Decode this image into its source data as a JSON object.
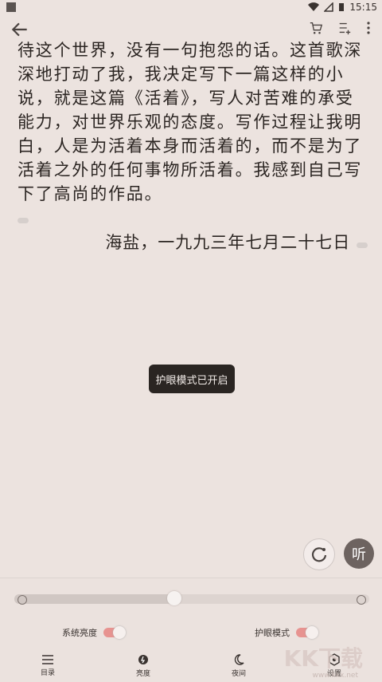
{
  "status": {
    "time": "15:15"
  },
  "reader": {
    "text": "待这个世界，没有一句抱怨的话。这首歌深深地打动了我，我决定写下一篇这样的小说，就是这篇《活着》，写人对苦难的承受能力，对世界乐观的态度。写作过程让我明白，人是为活着本身而活着的，而不是为了活着之外的任何事物所活着。我感到自己写下了高尚的作品。",
    "signature": "海盐，一九九三年七月二十七日"
  },
  "toast": "护眼模式已开启",
  "fab": {
    "listen": "听"
  },
  "brightness": {
    "level_percent": 45
  },
  "toggles": {
    "system_brightness": "系统亮度",
    "eye_protection": "护眼模式"
  },
  "nav": {
    "catalog": "目录",
    "brightness": "亮度",
    "night": "夜间",
    "settings": "设置"
  },
  "watermark": {
    "main": "KK下载",
    "sub": "www.kkx.net"
  },
  "colors": {
    "accent": "#e79390",
    "toast_bg": "#2a2522",
    "page_bg": "#ece3df"
  }
}
